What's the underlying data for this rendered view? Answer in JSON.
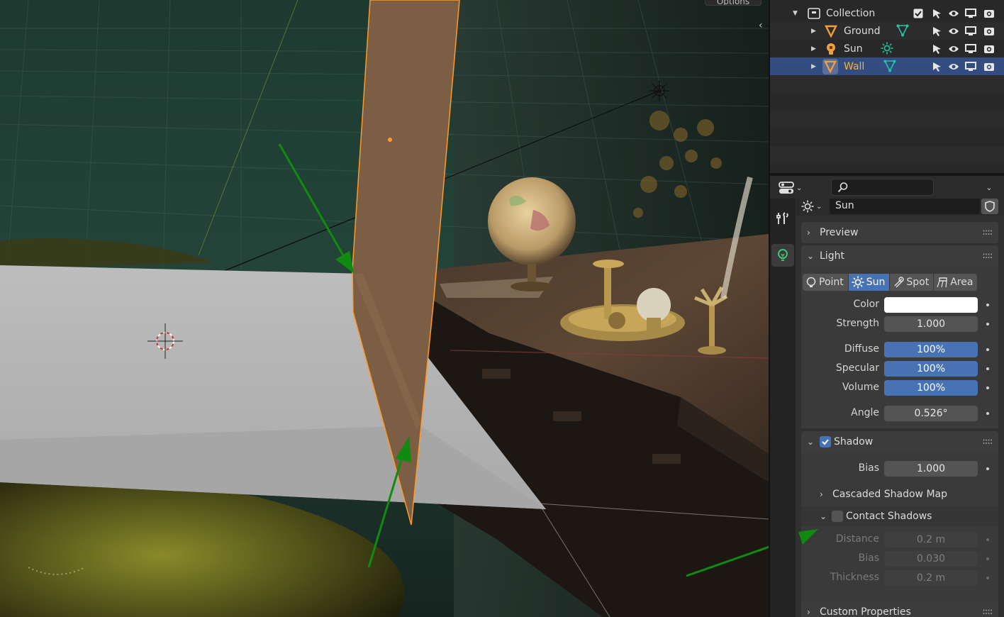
{
  "viewport": {
    "options_label": "Options"
  },
  "outliner": {
    "rows": [
      {
        "name": "Collection"
      },
      {
        "name": "Ground"
      },
      {
        "name": "Sun"
      },
      {
        "name": "Wall"
      }
    ]
  },
  "properties": {
    "search_placeholder": "",
    "datablock_name": "Sun",
    "panels": {
      "preview": "Preview",
      "light": "Light",
      "shadow": "Shadow",
      "cascaded": "Cascaded Shadow Map",
      "contact": "Contact Shadows",
      "custom": "Custom Properties"
    },
    "light_types": [
      "Point",
      "Sun",
      "Spot",
      "Area"
    ],
    "light_type_active": "Sun",
    "fields": {
      "color_label": "Color",
      "color_value": "#ffffff",
      "strength_label": "Strength",
      "strength_value": "1.000",
      "diffuse_label": "Diffuse",
      "diffuse_value": "100%",
      "specular_label": "Specular",
      "specular_value": "100%",
      "volume_label": "Volume",
      "volume_value": "100%",
      "angle_label": "Angle",
      "angle_value": "0.526°",
      "shadow_bias_label": "Bias",
      "shadow_bias_value": "1.000",
      "distance_label": "Distance",
      "distance_value": "0.2 m",
      "contact_bias_label": "Bias",
      "contact_bias_value": "0.030",
      "thickness_label": "Thickness",
      "thickness_value": "0.2 m"
    },
    "shadow_enabled": true,
    "contact_shadows_enabled": false
  },
  "colors": {
    "accent_blue": "#4772b3",
    "selected_row": "#334d80",
    "selected_text": "#ffaf29",
    "arrow_green": "#118a11"
  }
}
